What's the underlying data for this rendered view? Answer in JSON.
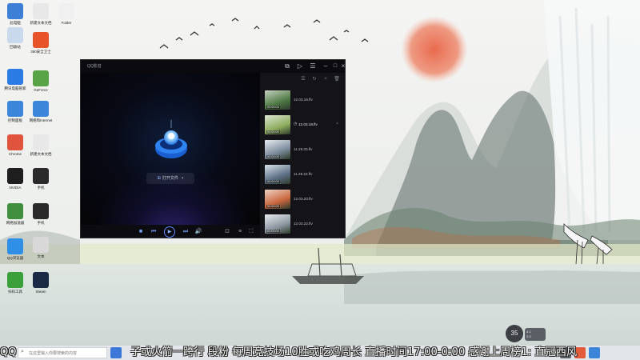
{
  "desktop": {
    "icons": [
      {
        "label": "此电脑",
        "color": "#3d7fd6"
      },
      {
        "label": "新建文本文档",
        "color": "#e8e8e8"
      },
      {
        "label": "Folder",
        "color": "#f0f0f0"
      },
      {
        "label": "回收站",
        "color": "#c9d9ec"
      },
      {
        "label": "360安全卫士",
        "color": "#e8542a"
      },
      {
        "label": "腾讯电脑管家",
        "color": "#2b7be4"
      },
      {
        "label": "GeForce",
        "color": "#58a345"
      },
      {
        "label": "控制面板",
        "color": "#3b86d8"
      },
      {
        "label": "网络和Internet",
        "color": "#3b86d8"
      },
      {
        "label": "Chrome",
        "color": "#e0533d"
      },
      {
        "label": "新建文本文档",
        "color": "#e8e8e8"
      },
      {
        "label": "NVIDIA",
        "color": "#1e1e1e"
      },
      {
        "label": "手机",
        "color": "#2a2a2a"
      },
      {
        "label": "网络加速器",
        "color": "#3f8f3f"
      },
      {
        "label": "手机",
        "color": "#2a2a2a"
      },
      {
        "label": "QQ浏览器",
        "color": "#2f8fe6"
      },
      {
        "label": "文本",
        "color": "#d8d8d8"
      },
      {
        "label": "扫码工具",
        "color": "#3aa13a"
      },
      {
        "label": "Steam",
        "color": "#1b2a44"
      }
    ]
  },
  "player": {
    "title": "QQ影音",
    "open_file_label": "打开文件",
    "playlist": [
      {
        "name": "12.03.16.flv",
        "duration": "02:00:04",
        "current": false
      },
      {
        "name": "12.03.18.flv",
        "duration": "02:00:00",
        "current": true
      },
      {
        "name": "11.29.20.flv",
        "duration": "02:00:03",
        "current": false
      },
      {
        "name": "11.29.22.flv",
        "duration": "02:00:00",
        "current": false
      },
      {
        "name": "12.03.20.flv",
        "duration": "02:00:00",
        "current": false
      },
      {
        "name": "12.03.22.flv",
        "duration": "02:00:00",
        "current": false
      }
    ]
  },
  "weather": {
    "temperature": "35",
    "detail_line1": "4.1",
    "detail_line2": "3.3"
  },
  "taskbar": {
    "start_label": "QQ",
    "search_placeholder": "在这里输入你要搜索的内容"
  },
  "overlay": {
    "left_text": "QQ",
    "marquee": "子或火箭一跨行 段粉 每周竞技场10胜或吃鸡周长 直播时间17:00-0:00 感谢上周榜1: 直冠西风"
  },
  "colors": {
    "accent_blue": "#5d8bff",
    "taskbar_bg": "#e1e4e8"
  }
}
